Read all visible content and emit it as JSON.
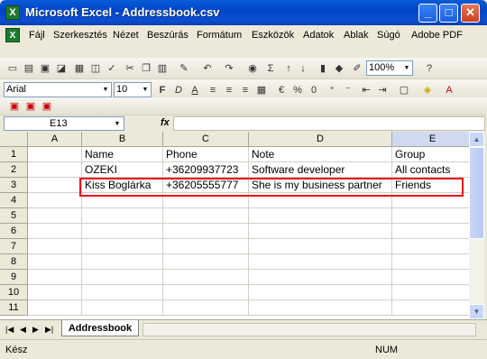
{
  "window": {
    "title": "Microsoft Excel - Addressbook.csv"
  },
  "menu": [
    "Fájl",
    "Szerkesztés",
    "Nézet",
    "Beszúrás",
    "Formátum",
    "Eszközök",
    "Adatok",
    "Ablak",
    "Súgó",
    "Adobe PDF"
  ],
  "formatting": {
    "font": "Arial",
    "size": "10",
    "zoom": "100%"
  },
  "formula_bar": {
    "name_box": "E13",
    "fx": "fx"
  },
  "grid": {
    "columns": [
      "A",
      "B",
      "C",
      "D",
      "E"
    ],
    "rows": [
      "1",
      "2",
      "3",
      "4",
      "5",
      "6",
      "7",
      "8",
      "9",
      "10",
      "11"
    ],
    "cells": [
      [
        "",
        "Name",
        "Phone",
        "Note",
        "Group"
      ],
      [
        "",
        "OZEKI",
        "+36209937723",
        "Software developer",
        "All contacts"
      ],
      [
        "",
        "Kiss Boglárka",
        "+36205555777",
        "She is my business partner",
        "Friends"
      ]
    ]
  },
  "sheet_tab": "Addressbook",
  "status": {
    "left": "Kész",
    "num": "NUM"
  }
}
